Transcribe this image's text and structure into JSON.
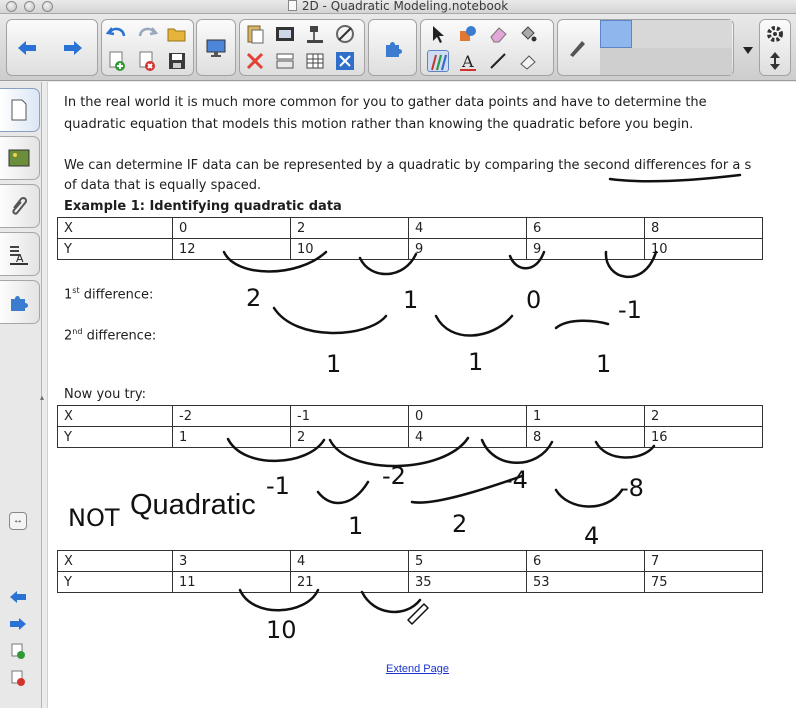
{
  "window": {
    "title": "2D - Quadratic Modeling.notebook"
  },
  "toolbar": {
    "buttons": [
      "back-arrow-icon",
      "forward-arrow-icon",
      "undo-icon",
      "redo-icon",
      "open-folder-icon",
      "add-page-icon",
      "delete-page-icon",
      "save-icon",
      "screen-shade-icon",
      "paste-icon",
      "screen-capture-icon",
      "document-camera-icon",
      "table-tools-icon",
      "delete-icon",
      "show-hide-icon",
      "table-icon",
      "fullscreen-icon",
      "addon-icon",
      "select-icon",
      "shapes-icon",
      "eraser-icon",
      "fill-icon",
      "pens-icon",
      "text-icon",
      "line-icon",
      "magic-eraser-icon",
      "pen-properties-icon",
      "dropdown-icon",
      "settings-gear-icon",
      "move-toolbar-icon"
    ]
  },
  "sidebar": {
    "tabs": [
      "page-sorter-icon",
      "gallery-icon",
      "attachments-icon",
      "properties-icon",
      "addon-icon"
    ],
    "bottom_buttons": [
      "previous-page-icon",
      "next-page-icon",
      "add-page-icon",
      "delete-page-icon"
    ]
  },
  "page": {
    "intro_line1": "In the real world it is much more common for you to gather data points and have to determine the",
    "intro_line2": "quadratic equation that models this motion rather than knowing the quadratic before you begin.",
    "if_line1": "We can determine IF data can be represented by a quadratic by comparing the second differences for a s",
    "if_line2": "of data that is equally spaced.",
    "example_title": "Example 1: Identifying quadratic data",
    "first_diff_base": "1",
    "first_diff_sup": "st",
    "first_diff_label": " difference:",
    "second_diff_base": "2",
    "second_diff_sup": "nd",
    "second_diff_label": " difference:",
    "now_you_try": "Now you try:",
    "not_quadratic_text": "Quadratic",
    "extend_link": "Extend Page",
    "table1": {
      "x": [
        "X",
        "0",
        "2",
        "4",
        "6",
        "8"
      ],
      "y": [
        "Y",
        "12",
        "10",
        "9",
        "9",
        "10"
      ]
    },
    "table2": {
      "x": [
        "X",
        "-2",
        "-1",
        "0",
        "1",
        "2"
      ],
      "y": [
        "Y",
        "1",
        "2",
        "4",
        "8",
        "16"
      ]
    },
    "table3": {
      "x": [
        "X",
        "3",
        "4",
        "5",
        "6",
        "7"
      ],
      "y": [
        "Y",
        "11",
        "21",
        "35",
        "53",
        "75"
      ]
    }
  },
  "handwriting": {
    "t1_first_diffs": [
      "2",
      "1",
      "0",
      "-1"
    ],
    "t1_second_diffs": [
      "1",
      "1",
      "1"
    ],
    "t2_first_diffs": [
      "-1",
      "-2",
      "-4",
      "-8"
    ],
    "t2_second_diffs": [
      "1",
      "2",
      "4"
    ],
    "not_prefix": "NOT",
    "t3_first_diffs": [
      "10"
    ]
  },
  "colors": {
    "ink": "#111111",
    "link": "#1a33cc",
    "accent_blue": "#2f6fc9"
  }
}
